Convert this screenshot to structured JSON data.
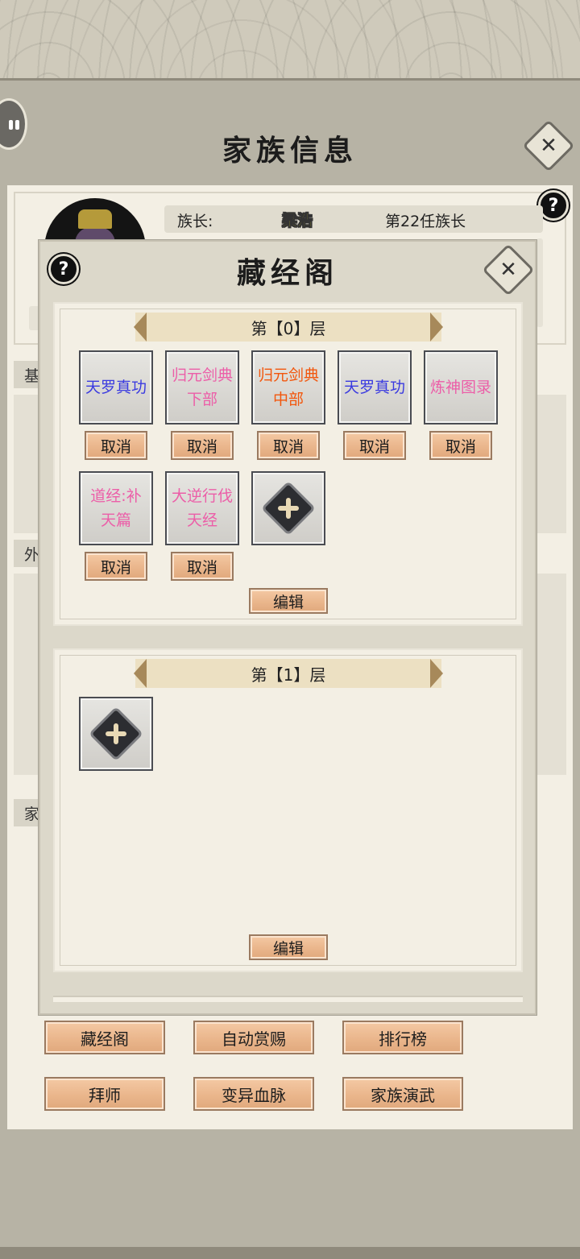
{
  "window": {
    "title": "家族信息"
  },
  "chief": {
    "label": "族长:",
    "name": "梁浩",
    "generation": "第22任族长"
  },
  "sections": {
    "basic_partial": "基",
    "outer_partial": "外",
    "family_partial": "家"
  },
  "bottom_buttons": [
    {
      "label": "藏经阁"
    },
    {
      "label": "自动赏赐"
    },
    {
      "label": "排行榜"
    },
    {
      "label": "拜师"
    },
    {
      "label": "变异血脉"
    },
    {
      "label": "家族演武"
    }
  ],
  "dialog": {
    "title": "藏经阁",
    "floors": [
      {
        "header": "第【0】层",
        "books": [
          {
            "lines": [
              "天罗真功"
            ],
            "color": "#3a3ae0",
            "action": "取消"
          },
          {
            "lines": [
              "归元剑典",
              "下部"
            ],
            "color": "#ec5ea8",
            "action": "取消"
          },
          {
            "lines": [
              "归元剑典",
              "中部"
            ],
            "color": "#f2560c",
            "action": "取消"
          },
          {
            "lines": [
              "天罗真功"
            ],
            "color": "#3a3ae0",
            "action": "取消"
          },
          {
            "lines": [
              "炼神图录"
            ],
            "color": "#ec5ea8",
            "action": "取消"
          },
          {
            "lines": [
              "道经:补",
              "天篇"
            ],
            "color": "#ec5ea8",
            "action": "取消"
          },
          {
            "lines": [
              "大逆行伐",
              "天经"
            ],
            "color": "#ec5ea8",
            "action": "取消"
          }
        ],
        "edit_label": "编辑"
      },
      {
        "header": "第【1】层",
        "books": [],
        "edit_label": "编辑"
      }
    ]
  },
  "icons": {
    "help": "?",
    "close": "✕"
  }
}
